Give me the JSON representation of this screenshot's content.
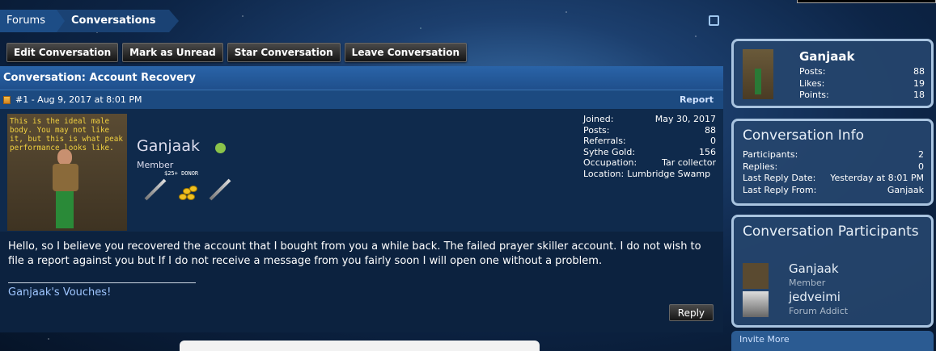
{
  "breadcrumb": {
    "items": [
      "Forums",
      "Conversations"
    ]
  },
  "actions": {
    "edit": "Edit Conversation",
    "mark_unread": "Mark as Unread",
    "star": "Star Conversation",
    "leave": "Leave Conversation"
  },
  "conversation": {
    "title": "Conversation: Account Recovery",
    "post": {
      "meta": "#1 - Aug 9, 2017 at 8:01 PM",
      "report": "Report",
      "avatar_caption": "This is the ideal male body. You may not like it, but this is what peak performance looks like.",
      "username": "Ganjaak",
      "role": "Member",
      "donor_badge": "$25+ DONOR",
      "stats": [
        {
          "label": "Joined:",
          "value": "May 30, 2017"
        },
        {
          "label": "Posts:",
          "value": "88"
        },
        {
          "label": "Referrals:",
          "value": "0"
        },
        {
          "label": "Sythe Gold:",
          "value": "156"
        },
        {
          "label": "Occupation:",
          "value": "Tar collector"
        }
      ],
      "location_label": "Location:",
      "location_value": "Lumbridge Swamp",
      "message": "Hello, so I believe you recovered the account that I bought from you a while back. The failed prayer skiller account. I do not wish to file a report against you but If I do not receive a message from you fairly soon I will open one without a problem.",
      "signature": "Ganjaak's Vouches!",
      "reply": "Reply"
    }
  },
  "sidebar": {
    "profile": {
      "name": "Ganjaak",
      "stats": [
        {
          "label": "Posts:",
          "value": "88"
        },
        {
          "label": "Likes:",
          "value": "19"
        },
        {
          "label": "Points:",
          "value": "18"
        }
      ]
    },
    "info": {
      "title": "Conversation Info",
      "rows": [
        {
          "label": "Participants:",
          "value": "2"
        },
        {
          "label": "Replies:",
          "value": "0"
        },
        {
          "label": "Last Reply Date:",
          "value": "Yesterday at 8:01 PM"
        },
        {
          "label": "Last Reply From:",
          "value": "Ganjaak"
        }
      ]
    },
    "participants": {
      "title": "Conversation Participants",
      "list": [
        {
          "name": "Ganjaak",
          "role": "Member"
        },
        {
          "name": "jedveimi",
          "role": "Forum Addict"
        }
      ]
    },
    "invite": "Invite More"
  }
}
